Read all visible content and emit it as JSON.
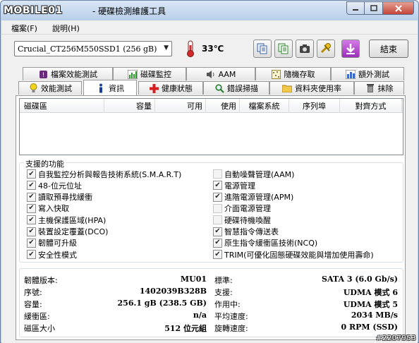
{
  "window": {
    "logo_text": "MOBILE01",
    "title": "- 硬碟檢測維護工具"
  },
  "menu": [
    "檔案(F)",
    "說明(H)"
  ],
  "toolbar": {
    "drive": "Crucial_CT256M550SSD1 (256 gB)",
    "temperature": "33℃",
    "end_label": "結束"
  },
  "tabs_top": [
    {
      "label": "檔案效能測試",
      "icon": "file-performance-icon"
    },
    {
      "label": "磁碟監控",
      "icon": "disk-monitor-icon"
    },
    {
      "label": "AAM",
      "icon": "speaker-icon"
    },
    {
      "label": "隨機存取",
      "icon": "random-access-icon"
    },
    {
      "label": "額外測試",
      "icon": "extra-test-icon"
    }
  ],
  "tabs_bottom": [
    {
      "label": "效能測試",
      "icon": "lightbulb-icon"
    },
    {
      "label": "資訊",
      "icon": "info-icon",
      "active": true
    },
    {
      "label": "健康狀態",
      "icon": "red-cross-icon"
    },
    {
      "label": "錯誤掃描",
      "icon": "magnifier-icon"
    },
    {
      "label": "資料夾使用率",
      "icon": "folder-icon"
    },
    {
      "label": "抹除",
      "icon": "trash-icon"
    }
  ],
  "list_columns": [
    "磁碟區",
    "容量",
    "可用",
    "使用",
    "檔案系統",
    "序列埠",
    "對齊方式"
  ],
  "features": {
    "title": "支援的功能",
    "left": [
      {
        "label": "自我監控分析與報告技術系統(S.M.A.R.T)",
        "checked": true
      },
      {
        "label": "48-位元位址",
        "checked": true
      },
      {
        "label": "讀取預尋找緩衝",
        "checked": true
      },
      {
        "label": "寫入快取",
        "checked": true
      },
      {
        "label": "主機保護區域(HPA)",
        "checked": true
      },
      {
        "label": "裝置設定覆蓋(DCO)",
        "checked": true
      },
      {
        "label": "韌體可升級",
        "checked": true
      },
      {
        "label": "安全性模式",
        "checked": true
      }
    ],
    "right": [
      {
        "label": "自動噪聲管理(AAM)",
        "checked": false
      },
      {
        "label": "電源管理",
        "checked": true
      },
      {
        "label": "進階電源管理(APM)",
        "checked": true
      },
      {
        "label": "介面電源管理",
        "checked": false
      },
      {
        "label": "硬碟待機喚醒",
        "checked": false
      },
      {
        "label": "智慧指令傳送表",
        "checked": true
      },
      {
        "label": "原生指令緩衝區技術(NCQ)",
        "checked": true
      },
      {
        "label": "TRIM(可優化固態硬碟效能與增加使用壽命)",
        "checked": true
      }
    ]
  },
  "info_left": [
    {
      "label": "韌體版本:",
      "value": "MU01"
    },
    {
      "label": "序號:",
      "value": "1402039B328B"
    },
    {
      "label": "容量:",
      "value": "256.1 gB (238.5 GB)"
    },
    {
      "label": "緩衝區:",
      "value": "n/a"
    },
    {
      "label": "磁區大小",
      "value": "512 位元組"
    }
  ],
  "info_right": [
    {
      "label": "標準:",
      "value": "SATA 3 (6.0 Gb/s)"
    },
    {
      "label": "支援:",
      "value": "UDMA 模式 6"
    },
    {
      "label": "作用中:",
      "value": "UDMA 模式 5"
    },
    {
      "label": "平均速度:",
      "value": "2034 MB/s"
    },
    {
      "label": "旋轉速度:",
      "value": "0 RPM (SSD)"
    }
  ],
  "watermark": "#2207953",
  "colors": {
    "titlebar": "#bcd0e8",
    "close": "#c5453a",
    "panel": "#ffffff"
  }
}
